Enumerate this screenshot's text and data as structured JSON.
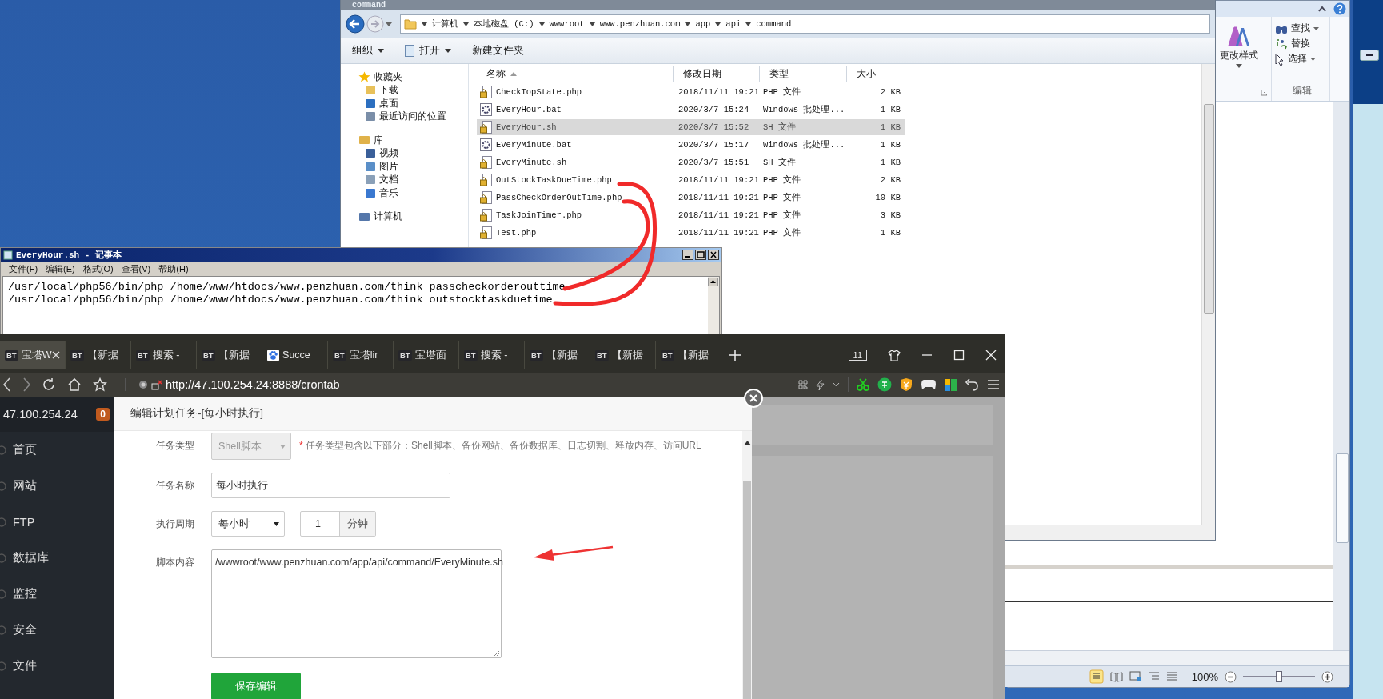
{
  "word": {
    "styles_label": "更改样式",
    "edit_items": [
      {
        "label": "查找",
        "kind": "find",
        "dropdown": true
      },
      {
        "label": "替换",
        "kind": "replace",
        "dropdown": false
      },
      {
        "label": "选择",
        "kind": "select",
        "dropdown": true
      }
    ],
    "group_label": "编辑",
    "zoom": {
      "label": "100%",
      "level": 0.5
    }
  },
  "explorer": {
    "title": "command",
    "breadcrumb": [
      "计算机",
      "本地磁盘 (C:)",
      "wwwroot",
      "www.penzhuan.com",
      "app",
      "api",
      "command"
    ],
    "toolbar": [
      {
        "label": "组织",
        "dropdown": true
      },
      {
        "label": "打开",
        "dropdown": true
      },
      {
        "label": "新建文件夹",
        "dropdown": false
      }
    ],
    "nav": [
      {
        "label": "收藏夹",
        "kind": "star",
        "children": [
          {
            "label": "下载",
            "kind": "download"
          },
          {
            "label": "桌面",
            "kind": "desktop"
          },
          {
            "label": "最近访问的位置",
            "kind": "recent"
          }
        ]
      },
      {
        "label": "库",
        "kind": "library",
        "children": [
          {
            "label": "视频",
            "kind": "video"
          },
          {
            "label": "图片",
            "kind": "image"
          },
          {
            "label": "文档",
            "kind": "document"
          },
          {
            "label": "音乐",
            "kind": "music"
          }
        ]
      },
      {
        "label": "计算机",
        "kind": "computer"
      }
    ],
    "columns": [
      "名称",
      "修改日期",
      "类型",
      "大小"
    ],
    "files": [
      {
        "name": "CheckTopState.php",
        "kind": "script",
        "date": "2018/11/11 19:21",
        "type": "PHP 文件",
        "size": "2 KB",
        "selected": false
      },
      {
        "name": "EveryHour.bat",
        "kind": "batch",
        "date": "2020/3/7 15:24",
        "type": "Windows 批处理...",
        "size": "1 KB",
        "selected": false
      },
      {
        "name": "EveryHour.sh",
        "kind": "script",
        "date": "2020/3/7 15:52",
        "type": "SH 文件",
        "size": "1 KB",
        "selected": true
      },
      {
        "name": "EveryMinute.bat",
        "kind": "batch",
        "date": "2020/3/7 15:17",
        "type": "Windows 批处理...",
        "size": "1 KB",
        "selected": false
      },
      {
        "name": "EveryMinute.sh",
        "kind": "script",
        "date": "2020/3/7 15:51",
        "type": "SH 文件",
        "size": "1 KB",
        "selected": false
      },
      {
        "name": "OutStockTaskDueTime.php",
        "kind": "script",
        "date": "2018/11/11 19:21",
        "type": "PHP 文件",
        "size": "2 KB",
        "selected": false
      },
      {
        "name": "PassCheckOrderOutTime.php",
        "kind": "script",
        "date": "2018/11/11 19:21",
        "type": "PHP 文件",
        "size": "10 KB",
        "selected": false
      },
      {
        "name": "TaskJoinTimer.php",
        "kind": "script",
        "date": "2018/11/11 19:21",
        "type": "PHP 文件",
        "size": "3 KB",
        "selected": false
      },
      {
        "name": "Test.php",
        "kind": "script",
        "date": "2018/11/11 19:21",
        "type": "PHP 文件",
        "size": "1 KB",
        "selected": false
      }
    ]
  },
  "notepad": {
    "title": "EveryHour.sh - 记事本",
    "menu": [
      "文件(F)",
      "编辑(E)",
      "格式(O)",
      "查看(V)",
      "帮助(H)"
    ],
    "lines": [
      "/usr/local/php56/bin/php /home/www/htdocs/www.penzhuan.com/think passcheckorderouttime",
      "/usr/local/php56/bin/php /home/www/htdocs/www.penzhuan.com/think outstocktaskduetime"
    ]
  },
  "browser": {
    "tabs": [
      {
        "label": "宝塔W",
        "icon_text": "BT",
        "selected": true
      },
      {
        "label": "【新据",
        "icon_text": "BT",
        "selected": false
      },
      {
        "label": "搜索 -",
        "icon_text": "BT",
        "selected": false
      },
      {
        "label": "【新据",
        "icon_text": "BT",
        "selected": false
      },
      {
        "label": "Succe",
        "selected": false
      },
      {
        "label": "宝塔lir",
        "icon_text": "BT",
        "selected": false
      },
      {
        "label": "宝塔面",
        "icon_text": "BT",
        "selected": false
      },
      {
        "label": "搜索 -",
        "icon_text": "BT",
        "selected": false
      },
      {
        "label": "【新据",
        "icon_text": "BT",
        "selected": false
      },
      {
        "label": "【新据",
        "icon_text": "BT",
        "selected": false
      },
      {
        "label": "【新据",
        "icon_text": "BT",
        "selected": false
      }
    ],
    "tab_count": "11",
    "url": "http://47.100.254.24:8888/crontab",
    "sidebar": {
      "server": "47.100.254.24",
      "badge": "0",
      "items": [
        "首页",
        "网站",
        "FTP",
        "数据库",
        "监控",
        "安全",
        "文件"
      ]
    },
    "modal": {
      "title": "编辑计划任务-[每小时执行]",
      "fields": [
        {
          "kind": "select",
          "label": "任务类型",
          "value": "Shell脚本",
          "disabled": true,
          "hint_mark": "*",
          "hint": "任务类型包含以下部分：Shell脚本、备份网站、备份数据库、日志切割、释放内存、访问URL"
        },
        {
          "kind": "text",
          "label": "任务名称",
          "value": "每小时执行"
        },
        {
          "kind": "period",
          "label": "执行周期",
          "value": "每小时",
          "disabled": false,
          "number": "1",
          "unit": "分钟"
        },
        {
          "kind": "textarea",
          "label": "脚本内容",
          "value": "/wwwroot/www.penzhuan.com/app/api/command/EveryMinute.sh"
        }
      ],
      "save": "保存编辑"
    }
  }
}
